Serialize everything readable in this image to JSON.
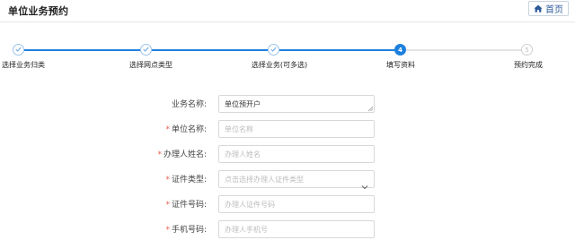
{
  "header": {
    "title": "单位业务预约",
    "home_label": "首页"
  },
  "steps": [
    {
      "number": "1",
      "label": "选择业务归类",
      "state": "done"
    },
    {
      "number": "2",
      "label": "选择网点类型",
      "state": "done"
    },
    {
      "number": "3",
      "label": "选择业务(可多选)",
      "state": "done"
    },
    {
      "number": "4",
      "label": "填写资料",
      "state": "active"
    },
    {
      "number": "5",
      "label": "预约完成",
      "state": "pending"
    }
  ],
  "form": {
    "business_name": {
      "label": "业务名称:",
      "value": "单位预开户",
      "required": false
    },
    "unit_name": {
      "label": "单位名称:",
      "placeholder": "单位名称",
      "required": true
    },
    "agent_name": {
      "label": "办理人姓名:",
      "placeholder": "办理人姓名",
      "required": true
    },
    "id_type": {
      "label": "证件类型:",
      "placeholder": "点击选择办理人证件类型",
      "required": true
    },
    "id_number": {
      "label": "证件号码:",
      "placeholder": "办理人证件号码",
      "required": true
    },
    "phone": {
      "label": "手机号码:",
      "placeholder": "办理人手机号",
      "required": true
    }
  },
  "colors": {
    "accent": "#1e80dd",
    "required_mark": "#e85a4f",
    "home_text": "#2c5a99"
  },
  "icons": {
    "done": "check-icon",
    "home": "home-icon",
    "select": "chevron-down-icon"
  }
}
